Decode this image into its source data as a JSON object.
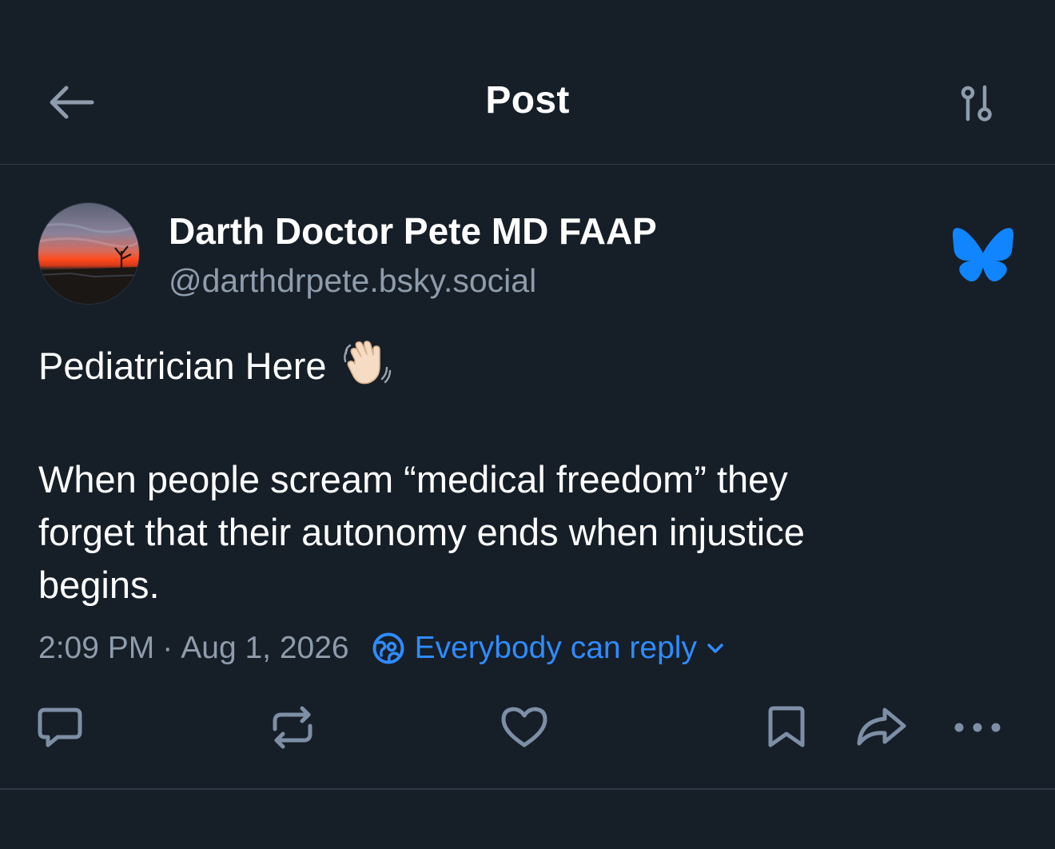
{
  "header": {
    "title": "Post",
    "back_icon": "arrow-left-icon",
    "filter_icon": "sliders-icon"
  },
  "author": {
    "display_name": "Darth Doctor Pete MD FAAP",
    "handle": "@darthdrpete.bsky.social",
    "avatar": "sunset-landscape-avatar",
    "platform_logo": "bluesky-butterfly-icon"
  },
  "post": {
    "lines": [
      "Pediatrician Here",
      "",
      "When people scream “medical freedom” they",
      "forget that their autonomy ends when injustice",
      "begins."
    ],
    "emoji": "waving-hand-emoji"
  },
  "meta": {
    "time": "2:09 PM",
    "separator": "·",
    "date": "Aug 1, 2026",
    "reply_setting": "Everybody can reply",
    "reply_icon": "globe-icon"
  },
  "actions": [
    {
      "name": "reply-button",
      "icon": "speech-bubble-icon"
    },
    {
      "name": "repost-button",
      "icon": "repost-icon"
    },
    {
      "name": "like-button",
      "icon": "heart-icon"
    },
    {
      "name": "bookmark-button",
      "icon": "bookmark-icon"
    },
    {
      "name": "share-button",
      "icon": "share-arrow-icon"
    },
    {
      "name": "more-button",
      "icon": "ellipsis-icon"
    }
  ],
  "colors": {
    "background": "#161e27",
    "divider": "#2e3a48",
    "text_primary": "#ffffff",
    "text_secondary": "#8e9cac",
    "accent": "#2f8cff",
    "icon_muted": "#7d8fa6"
  }
}
